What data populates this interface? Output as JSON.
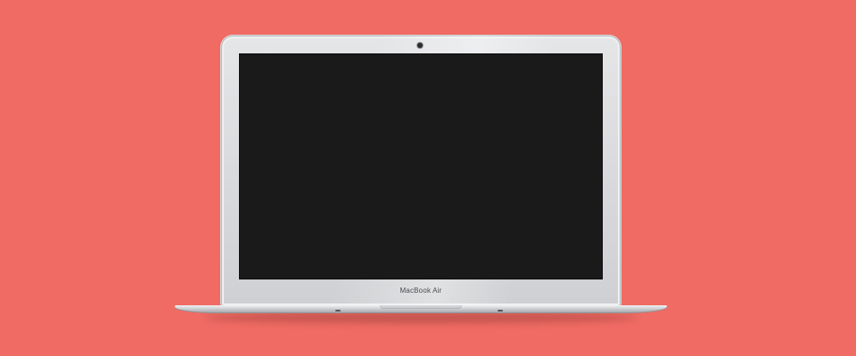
{
  "background_color": "#ef6b63",
  "device": {
    "brand_label": "MacBook Air",
    "screen_color": "#1a1a1a"
  }
}
